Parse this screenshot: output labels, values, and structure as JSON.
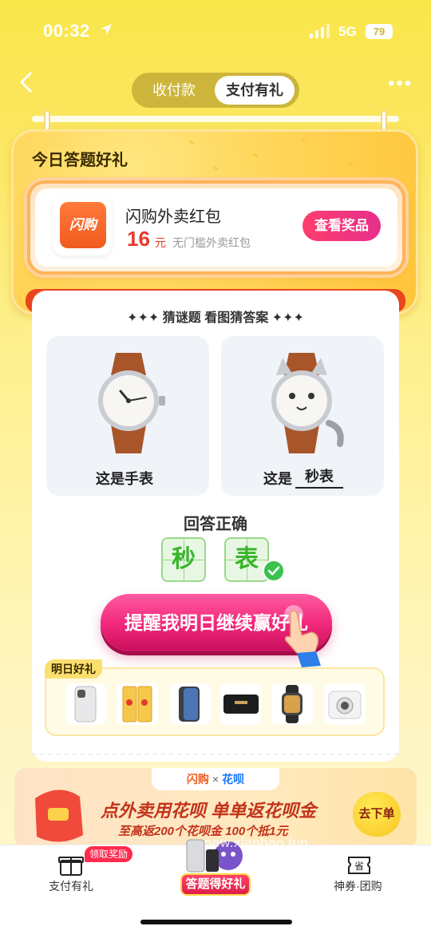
{
  "status_bar": {
    "time": "00:32",
    "network": "5G",
    "battery": "79"
  },
  "nav": {
    "segments": [
      "收付款",
      "支付有礼"
    ],
    "active_segment": "支付有礼"
  },
  "today": {
    "title": "今日答题好礼",
    "prize": {
      "logo_text": "闪购",
      "name": "闪购外卖红包",
      "amount": "16",
      "unit": "元",
      "desc": "无门槛外卖红包",
      "button": "查看奖品"
    }
  },
  "quiz": {
    "header": "✦✦✦ 猜谜题 看图猜答案 ✦✦✦",
    "left_caption": "这是手表",
    "right_caption_prefix": "这是",
    "right_caption_answer": "秒表",
    "result": "回答正确",
    "answer_chars": [
      "秒",
      "表"
    ],
    "remind_button": "提醒我明日继续赢好礼"
  },
  "tomorrow": {
    "tag": "明日好礼",
    "items": [
      "white-phone",
      "gold-bars",
      "black-phone",
      "speaker",
      "smartwatch",
      "instant-camera"
    ]
  },
  "promo": {
    "brand_left": "闪购",
    "brand_x": "×",
    "brand_right": "花呗",
    "title": "点外卖用花呗 单单返花呗金",
    "subtitle": "至高返200个花呗金 100个抵1元",
    "button": "去下单"
  },
  "watermark": "new.xianbao.fun",
  "tabbar": {
    "left_label": "支付有礼",
    "left_badge": "领取奖励",
    "center_label": "答题得好礼",
    "right_label": "神券·团购"
  },
  "colors": {
    "accent": "#f0267a",
    "brand_yellow": "#f9e64a",
    "price_red": "#e8382c",
    "success_green": "#38b52a"
  }
}
